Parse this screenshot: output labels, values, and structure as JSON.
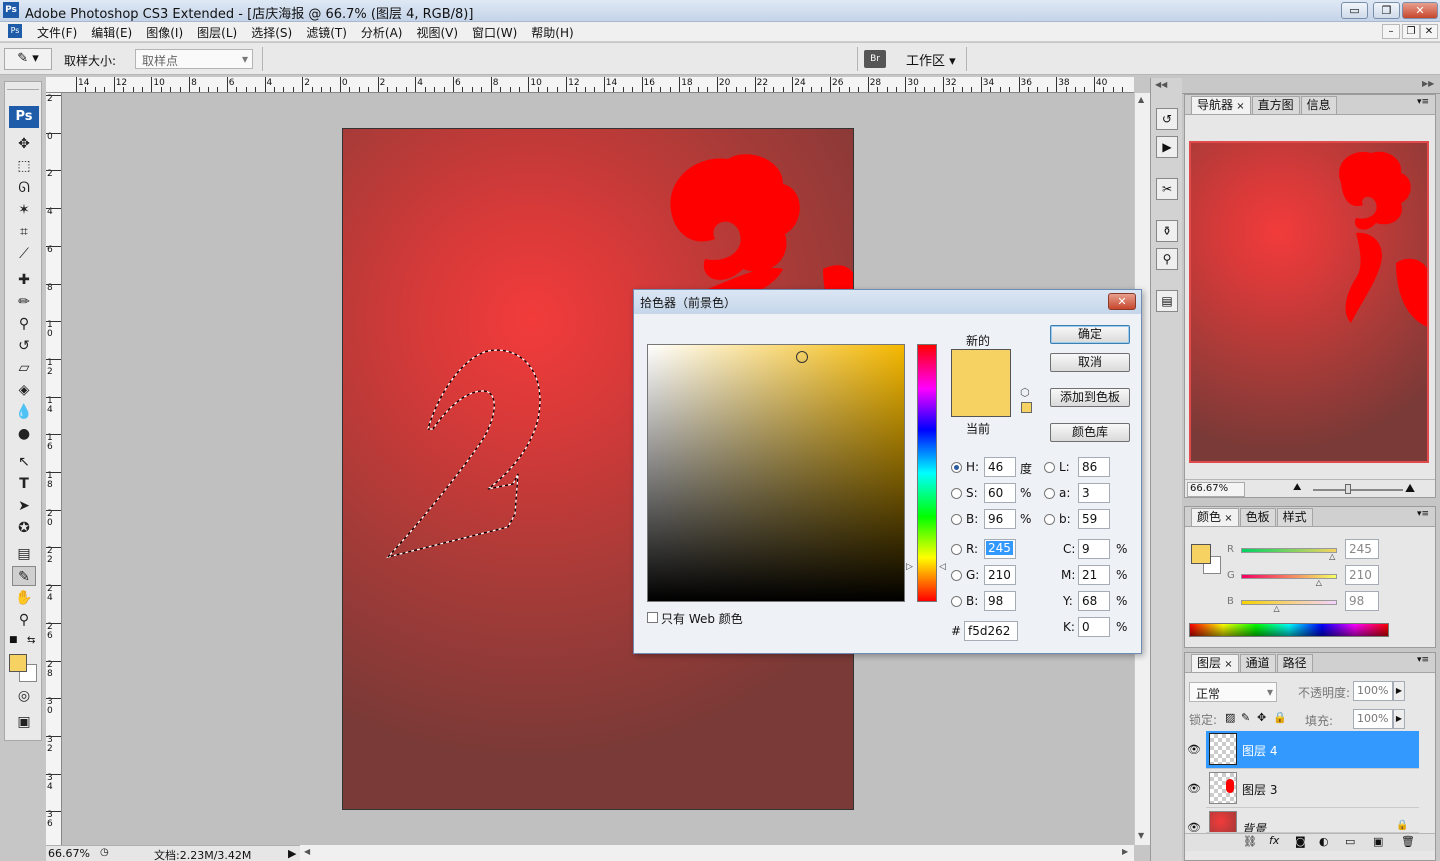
{
  "window": {
    "title": "Adobe Photoshop CS3 Extended - [店庆海报 @ 66.7% (图层 4, RGB/8)]",
    "app_badge": "Ps",
    "min": "▭",
    "restore": "❐",
    "close": "✕"
  },
  "menu": {
    "items": [
      "文件(F)",
      "编辑(E)",
      "图像(I)",
      "图层(L)",
      "选择(S)",
      "滤镜(T)",
      "分析(A)",
      "视图(V)",
      "窗口(W)",
      "帮助(H)"
    ],
    "mdi_min": "–",
    "mdi_restore": "❐",
    "mdi_close": "✕"
  },
  "options": {
    "sample_size_label": "取样大小:",
    "sample_size_value": "取样点",
    "workspace_label": "工作区 ▾"
  },
  "toolbox": {
    "logo": "Ps"
  },
  "rulers": {
    "h": [
      "14",
      "12",
      "10",
      "8",
      "6",
      "4",
      "2",
      "0",
      "2",
      "4",
      "6",
      "8",
      "10",
      "12",
      "14",
      "16",
      "18",
      "20",
      "22",
      "24",
      "26",
      "28",
      "30",
      "32",
      "34",
      "36",
      "38",
      "40"
    ],
    "v": [
      "2",
      "0",
      "2",
      "4",
      "6",
      "8",
      "10",
      "12",
      "14",
      "16",
      "18",
      "20",
      "22",
      "24",
      "26",
      "28",
      "30",
      "32",
      "34",
      "36"
    ]
  },
  "status": {
    "zoom": "66.67%",
    "doc": "文档:2.23M/3.42M"
  },
  "dialog": {
    "title": "拾色器（前景色）",
    "close": "✕",
    "ok": "确定",
    "cancel": "取消",
    "add_swatch": "添加到色板",
    "libraries": "颜色库",
    "new_label": "新的",
    "current_label": "当前",
    "web_only": "只有 Web 颜色",
    "hash": "#",
    "hex": "f5d262",
    "fields": {
      "H": {
        "label": "H:",
        "value": "46",
        "unit": "度"
      },
      "S": {
        "label": "S:",
        "value": "60",
        "unit": "%"
      },
      "Bv": {
        "label": "B:",
        "value": "96",
        "unit": "%"
      },
      "R": {
        "label": "R:",
        "value": "245"
      },
      "G": {
        "label": "G:",
        "value": "210"
      },
      "Bc": {
        "label": "B:",
        "value": "98"
      },
      "L": {
        "label": "L:",
        "value": "86"
      },
      "a": {
        "label": "a:",
        "value": "3"
      },
      "b": {
        "label": "b:",
        "value": "59"
      },
      "C": {
        "label": "C:",
        "value": "9",
        "unit": "%"
      },
      "M": {
        "label": "M:",
        "value": "21",
        "unit": "%"
      },
      "Y": {
        "label": "Y:",
        "value": "68",
        "unit": "%"
      },
      "K": {
        "label": "K:",
        "value": "0",
        "unit": "%"
      }
    },
    "new_color": "#f5d262",
    "current_color": "#f5d262"
  },
  "navigator": {
    "tabs": [
      "导航器",
      "直方图",
      "信息"
    ],
    "zoom": "66.67%"
  },
  "color_panel": {
    "tabs": [
      "颜色",
      "色板",
      "样式"
    ],
    "R": {
      "label": "R",
      "value": "245",
      "fraction": 0.96
    },
    "G": {
      "label": "G",
      "value": "210",
      "fraction": 0.82
    },
    "B": {
      "label": "B",
      "value": "98",
      "fraction": 0.38
    },
    "fg_color": "#f5d262"
  },
  "layers_panel": {
    "tabs": [
      "图层",
      "通道",
      "路径"
    ],
    "blend_mode": "正常",
    "opacity_label": "不透明度:",
    "opacity_value": "100%",
    "lock_label": "锁定:",
    "fill_label": "填充:",
    "fill_value": "100%",
    "layers": [
      {
        "name": "图层 4",
        "selected": true
      },
      {
        "name": "图层 3",
        "selected": false
      },
      {
        "name": "背景",
        "selected": false
      }
    ]
  },
  "colors": {
    "accent_selected": "#3399ff",
    "cloud_red": "#ff0000"
  }
}
